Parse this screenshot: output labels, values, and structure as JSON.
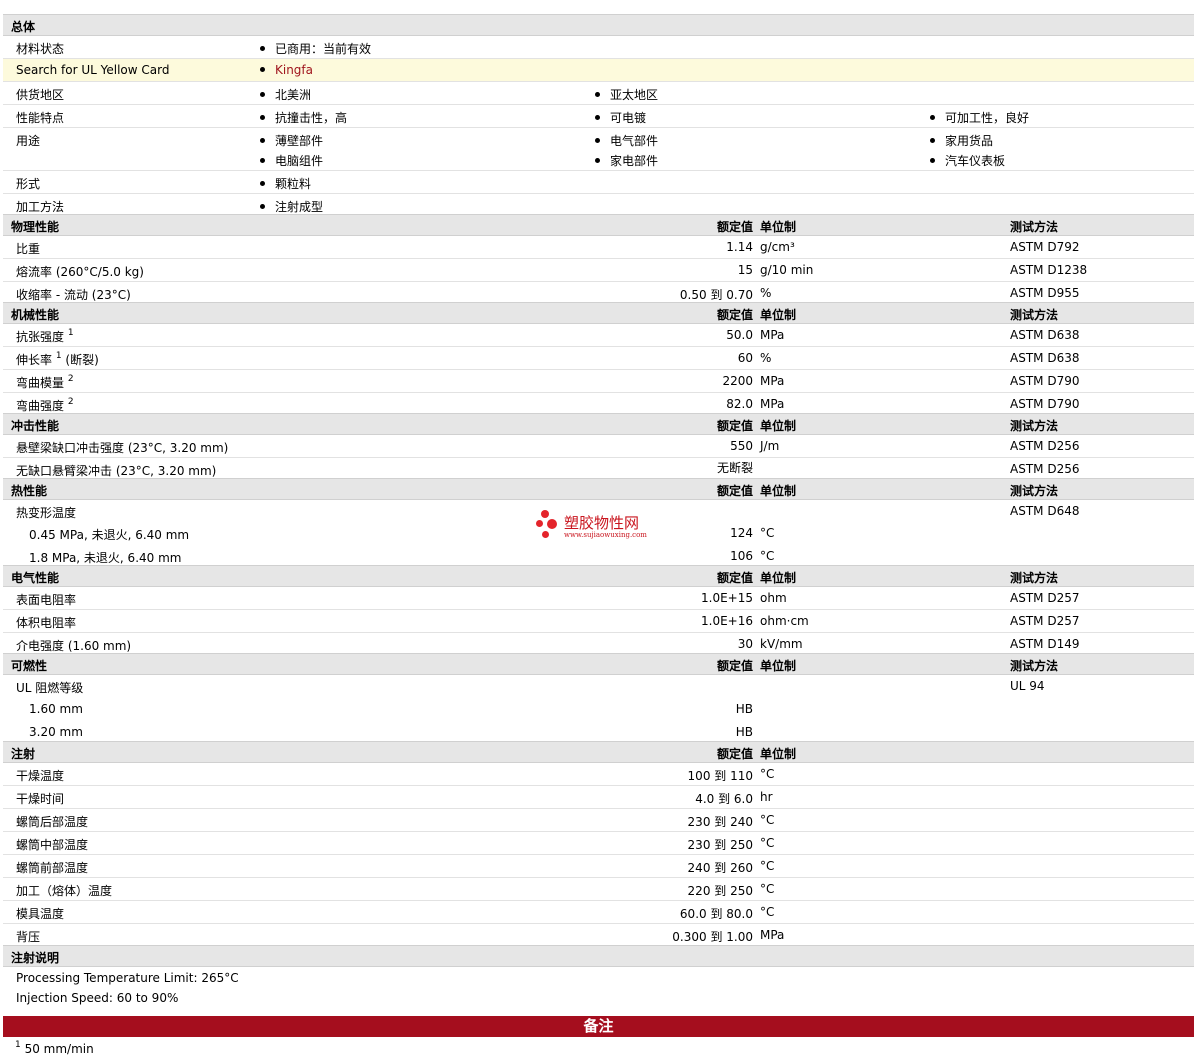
{
  "general": {
    "title": "总体",
    "rows": [
      {
        "label": "材料状态",
        "items": [
          "已商用：当前有效"
        ]
      },
      {
        "label": "Search for UL Yellow Card",
        "items": [
          "Kingfa"
        ]
      },
      {
        "label": "供货地区",
        "items": [
          "北美洲",
          "亚太地区"
        ]
      },
      {
        "label": "性能特点",
        "items": [
          "抗撞击性，高",
          "可电镀",
          "可加工性，良好"
        ]
      },
      {
        "label": "用途",
        "items": [
          "薄壁部件",
          "电气部件",
          "家用货品",
          "电脑组件",
          "家电部件",
          "汽车仪表板"
        ]
      },
      {
        "label": "形式",
        "items": [
          "颗粒料"
        ]
      },
      {
        "label": "加工方法",
        "items": [
          "注射成型"
        ]
      }
    ]
  },
  "col_headers": {
    "value": "额定值",
    "unit": "单位制",
    "method": "测试方法"
  },
  "physical": {
    "title": "物理性能",
    "rows": [
      {
        "label": "比重",
        "value": "1.14",
        "unit": "g/cm³",
        "method": "ASTM D792"
      },
      {
        "label": "熔流率  (260°C/5.0 kg)",
        "value": "15",
        "unit": "g/10 min",
        "method": "ASTM D1238"
      },
      {
        "label": "收缩率  - 流动  (23°C)",
        "value": "0.50 到  0.70",
        "unit": "%",
        "method": "ASTM D955"
      }
    ]
  },
  "mechanical": {
    "title": "机械性能",
    "rows": [
      {
        "label": "抗张强度",
        "sup": "1",
        "suffix": "",
        "value": "50.0",
        "unit": "MPa",
        "method": "ASTM D638"
      },
      {
        "label": "伸长率",
        "sup": "1",
        "suffix": "(断裂)",
        "value": "60",
        "unit": "%",
        "method": "ASTM D638"
      },
      {
        "label": "弯曲模量",
        "sup": "2",
        "suffix": "",
        "value": "2200",
        "unit": "MPa",
        "method": "ASTM D790"
      },
      {
        "label": "弯曲强度",
        "sup": "2",
        "suffix": "",
        "value": "82.0",
        "unit": "MPa",
        "method": "ASTM D790"
      }
    ]
  },
  "impact": {
    "title": "冲击性能",
    "rows": [
      {
        "label": "悬壁梁缺口冲击强度  (23°C, 3.20 mm)",
        "value": "550",
        "unit": "J/m",
        "method": "ASTM D256"
      },
      {
        "label": "无缺口悬臂梁冲击  (23°C, 3.20 mm)",
        "value": "无断裂",
        "unit": "",
        "method": "ASTM D256"
      }
    ]
  },
  "thermal": {
    "title": "热性能",
    "rows": [
      {
        "label": "热变形温度",
        "value": "",
        "unit": "",
        "method": "ASTM D648"
      },
      {
        "label": "0.45 MPa, 未退火, 6.40 mm",
        "value": "124",
        "unit": "°C",
        "method": ""
      },
      {
        "label": "1.8 MPa, 未退火, 6.40 mm",
        "value": "106",
        "unit": "°C",
        "method": ""
      }
    ]
  },
  "electrical": {
    "title": "电气性能",
    "rows": [
      {
        "label": "表面电阻率",
        "value": "1.0E+15",
        "unit": "ohm",
        "method": "ASTM D257"
      },
      {
        "label": "体积电阻率",
        "value": "1.0E+16",
        "unit": "ohm·cm",
        "method": "ASTM D257"
      },
      {
        "label": "介电强度  (1.60 mm)",
        "value": "30",
        "unit": "kV/mm",
        "method": "ASTM D149"
      }
    ]
  },
  "flammability": {
    "title": "可燃性",
    "rows": [
      {
        "label": "UL 阻燃等级",
        "value": "",
        "unit": "",
        "method": "UL 94"
      },
      {
        "label": "1.60 mm",
        "value": "HB",
        "unit": "",
        "method": ""
      },
      {
        "label": "3.20 mm",
        "value": "HB",
        "unit": "",
        "method": ""
      }
    ]
  },
  "injection": {
    "title": "注射",
    "rows": [
      {
        "label": "干燥温度",
        "value": "100 到  110",
        "unit": "°C"
      },
      {
        "label": "干燥时间",
        "value": "4.0 到  6.0",
        "unit": "hr"
      },
      {
        "label": "螺筒后部温度",
        "value": "230 到  240",
        "unit": "°C"
      },
      {
        "label": "螺筒中部温度",
        "value": "230 到  250",
        "unit": "°C"
      },
      {
        "label": "螺筒前部温度",
        "value": "240 到  260",
        "unit": "°C"
      },
      {
        "label": "加工（熔体）温度",
        "value": "220 到  250",
        "unit": "°C"
      },
      {
        "label": "模具温度",
        "value": "60.0 到  80.0",
        "unit": "°C"
      },
      {
        "label": "背压",
        "value": "0.300 到  1.00",
        "unit": "MPa"
      }
    ]
  },
  "injection_notes": {
    "title": "注射说明",
    "lines": [
      "Processing Temperature Limit: 265°C",
      "Injection Speed: 60 to 90%"
    ]
  },
  "remarks": {
    "title": "备注",
    "footnote_num": "1",
    "footnote_text": "50 mm/min"
  },
  "watermark": {
    "cn": "塑胶物性网",
    "en": "www.sujiaowuxing.com"
  },
  "colors": {
    "band": "#a50e1e",
    "section": "#e6e6e6",
    "highlight": "#fdfadc",
    "link": "#a0161e"
  }
}
